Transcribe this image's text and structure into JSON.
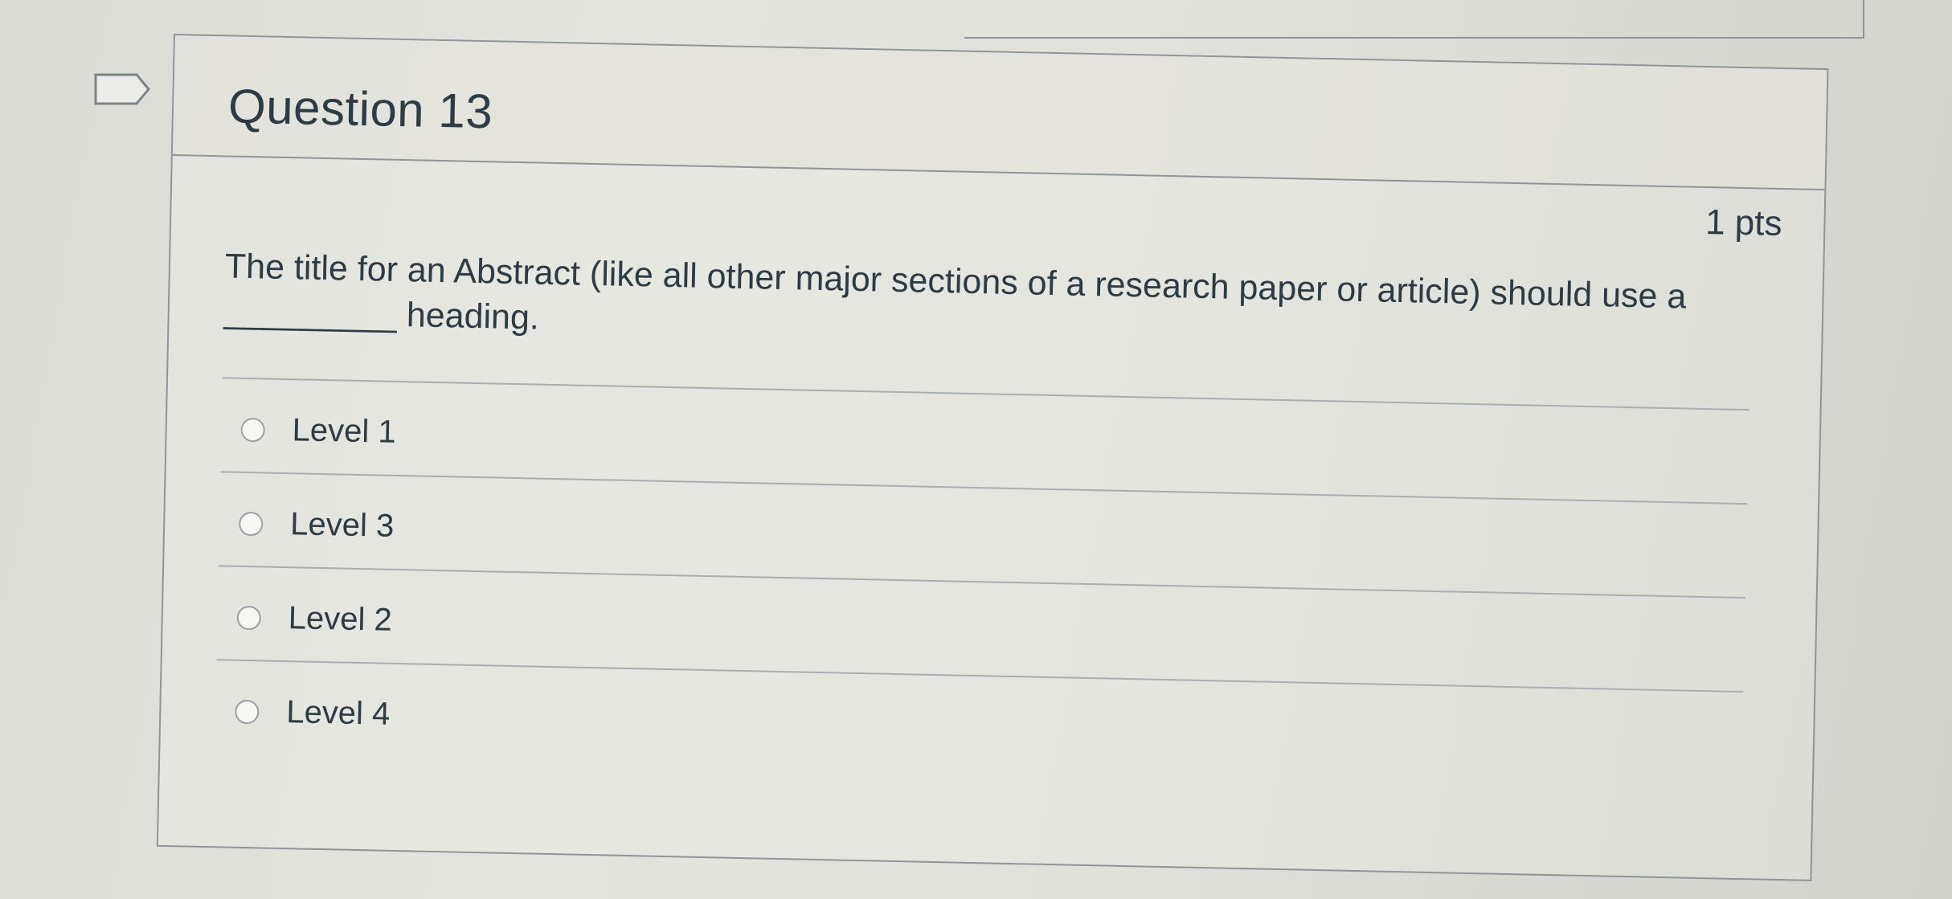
{
  "question": {
    "title": "Question 13",
    "points": "1 pts",
    "text": "The title for an Abstract (like all other major sections of a research paper or article) should use a _________ heading."
  },
  "answers": [
    {
      "label": "Level 1"
    },
    {
      "label": "Level 3"
    },
    {
      "label": "Level 2"
    },
    {
      "label": "Level 4"
    }
  ],
  "icons": {
    "flag": "flag-icon"
  }
}
